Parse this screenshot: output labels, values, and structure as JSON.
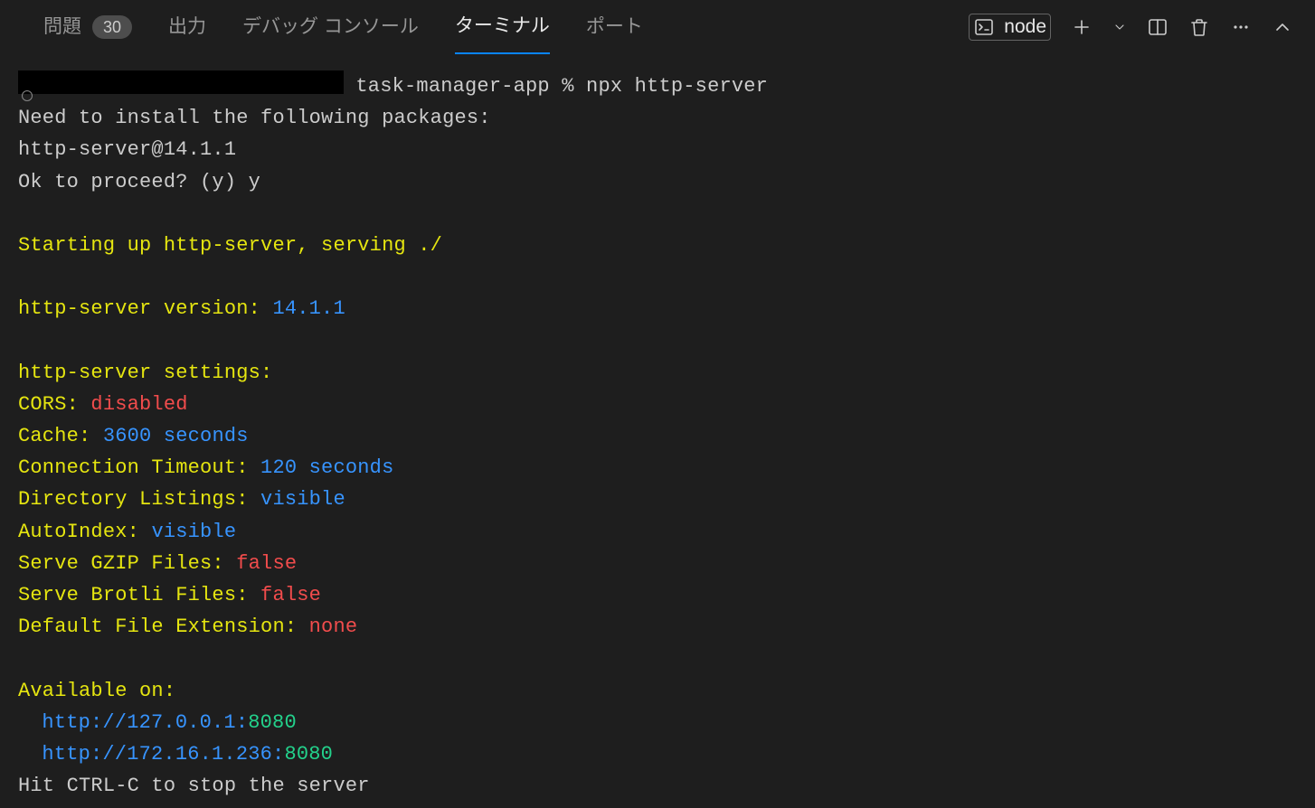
{
  "tabs": {
    "problems": {
      "label": "問題",
      "badge": "30"
    },
    "output": {
      "label": "出力"
    },
    "debug_console": {
      "label": "デバッグ コンソール"
    },
    "terminal": {
      "label": "ターミナル"
    },
    "ports": {
      "label": "ポート"
    }
  },
  "actions": {
    "shell_name": "node"
  },
  "terminal": {
    "prompt_suffix": " task-manager-app % npx http-server",
    "install_prompt": "Need to install the following packages:",
    "pkg": "http-server@14.1.1",
    "proceed": "Ok to proceed? (y) y",
    "starting_prefix": "Starting up http-server, serving ",
    "starting_path": "./",
    "version_label": "http-server version: ",
    "version_value": "14.1.1",
    "settings_label": "http-server settings: ",
    "cors_label": "CORS: ",
    "cors_value": "disabled",
    "cache_label": "Cache: ",
    "cache_value": "3600 seconds",
    "timeout_label": "Connection Timeout: ",
    "timeout_value": "120 seconds",
    "dirlist_label": "Directory Listings: ",
    "dirlist_value": "visible",
    "autoindex_label": "AutoIndex: ",
    "autoindex_value": "visible",
    "gzip_label": "Serve GZIP Files: ",
    "gzip_value": "false",
    "brotli_label": "Serve Brotli Files: ",
    "brotli_value": "false",
    "defext_label": "Default File Extension: ",
    "defext_value": "none",
    "available_label": "Available on:",
    "addr1_prefix": "http://127.0.0.1:",
    "addr1_port": "8080",
    "addr2_prefix": "http://172.16.1.236:",
    "addr2_port": "8080",
    "stop_hint": "Hit CTRL-C to stop the server"
  }
}
